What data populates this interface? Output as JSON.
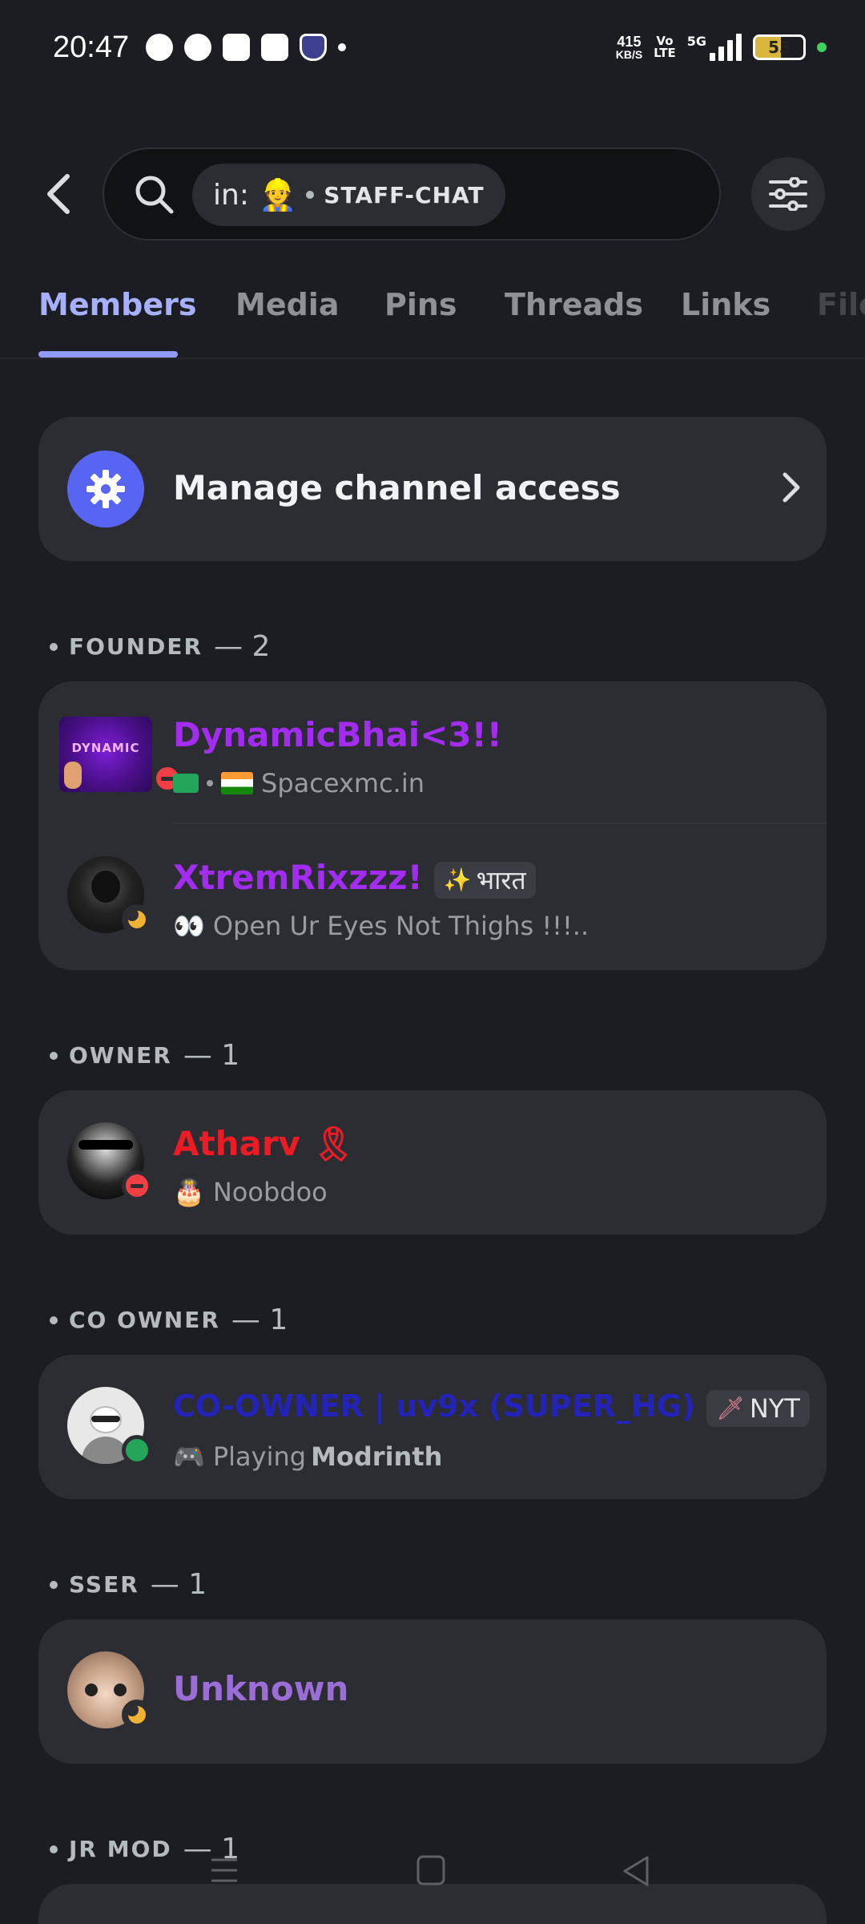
{
  "status_bar": {
    "time": "20:47",
    "speed_value": "415",
    "speed_unit": "KB/S",
    "volte_top": "Vo",
    "volte_bottom": "LTE",
    "network": "5G",
    "battery": "53",
    "notification_icons": [
      "whatsapp-icon",
      "messages-icon",
      "discord-icon",
      "shopping-bag-icon",
      "shield-app-icon"
    ]
  },
  "search": {
    "in_label": "in:",
    "channel_emoji": "👷",
    "channel_name": "STAFF-CHAT"
  },
  "tabs": [
    {
      "label": "Members",
      "active": true
    },
    {
      "label": "Media",
      "active": false
    },
    {
      "label": "Pins",
      "active": false
    },
    {
      "label": "Threads",
      "active": false
    },
    {
      "label": "Links",
      "active": false
    },
    {
      "label": "Files",
      "active": false
    }
  ],
  "manage": {
    "label": "Manage channel access"
  },
  "sections": [
    {
      "name": "FOUNDER",
      "count": "— 2",
      "members": [
        {
          "name": "DynamicBhai<3!!",
          "name_color": "#a22cf0",
          "avatar_text": "DYNAMIC",
          "status": "dnd",
          "sub_icon": "🖥",
          "sub_flag": "🇮🇳",
          "sub": "Spacexmc.in"
        },
        {
          "name": "XtremRixzzz!",
          "name_color": "#a22cf0",
          "badge_icon": "✨",
          "badge": "भारत",
          "status": "idle",
          "sub_icon": "👀",
          "sub": "Open Ur Eyes Not Thighs !!!.."
        }
      ]
    },
    {
      "name": "OWNER",
      "count": "— 1",
      "members": [
        {
          "name": "Atharv",
          "name_color": "#ed1c24",
          "name_suffix": "🎗",
          "status": "dnd",
          "sub_icon": "🎂",
          "sub": "Noobdoo"
        }
      ]
    },
    {
      "name": "CO OWNER",
      "count": "— 1",
      "members": [
        {
          "name": "CO-OWNER | uv9x (SUPER_HG)",
          "name_color": "#2323b8",
          "badge_icon": "🗡",
          "badge": "NYT",
          "status": "online",
          "sub_icon": "🎮",
          "sub_prefix": "Playing",
          "sub": "Modrinth"
        }
      ]
    },
    {
      "name": "SSER",
      "count": "— 1",
      "members": [
        {
          "name": "Unknown",
          "name_color": "#9b6dd6",
          "status": "idle"
        }
      ]
    },
    {
      "name": "JR MOD",
      "count": "— 1",
      "members": []
    }
  ],
  "colors": {
    "background": "#1c1d22",
    "card": "#2b2d33",
    "accent": "#5865f2",
    "active_tab": "#a6b0ff"
  }
}
